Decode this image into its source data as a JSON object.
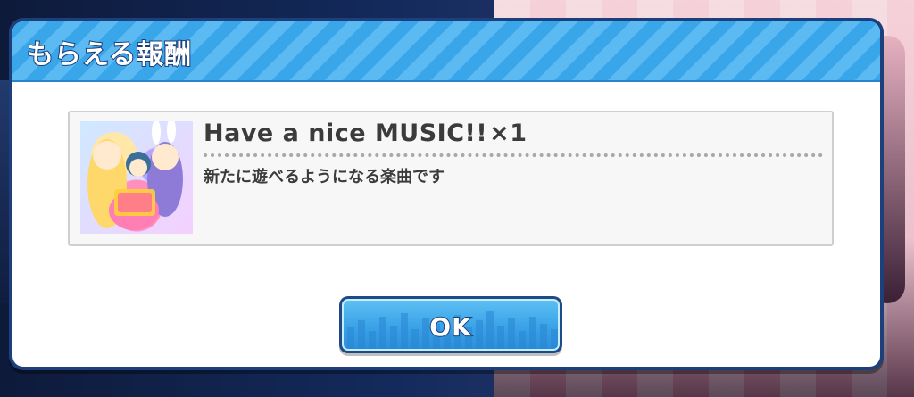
{
  "dialog": {
    "title": "もらえる報酬"
  },
  "reward": {
    "name": "Have a nice MUSIC!!",
    "quantity": "×1",
    "description": "新たに遊べるようになる楽曲です",
    "thumbnail_caption": "Have a nice MUSIC!!"
  },
  "button": {
    "ok_label": "OK"
  },
  "colors": {
    "header_blue": "#3aa6ea",
    "dialog_border": "#1d3f7c",
    "button_blue": "#3aa2e7"
  }
}
